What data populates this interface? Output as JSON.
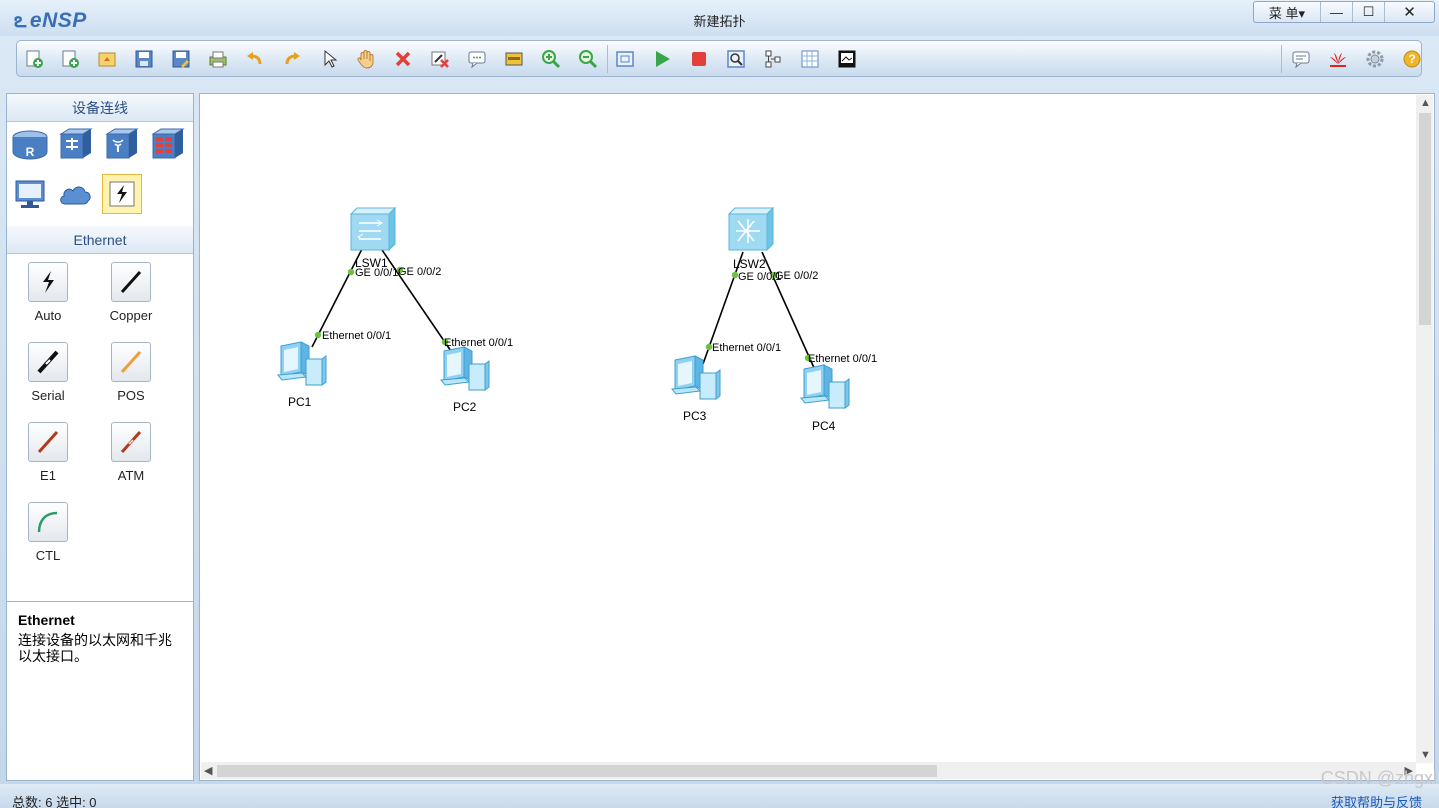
{
  "app": {
    "name": "eNSP",
    "window_title": "新建拓扑"
  },
  "window_buttons": {
    "menu": "菜 单▾",
    "minimize": "—",
    "maximize": "☐",
    "close": "✕"
  },
  "toolbar": {
    "buttons": [
      "new-topology-icon",
      "new-blank-topology-icon",
      "open-icon",
      "save-icon",
      "save-as-icon",
      "print-icon",
      "undo-icon",
      "redo-icon",
      "select-icon",
      "hand-icon",
      "delete-icon",
      "delete-link-icon",
      "text-comment-icon",
      "rectangle-icon",
      "zoom-in-icon",
      "zoom-out-icon",
      "fit-view-icon",
      "start-device-icon",
      "stop-device-icon",
      "capture-data-icon",
      "show-interfaces-icon",
      "palette-icon",
      "topology-icon"
    ],
    "right_buttons": [
      "chat-icon",
      "huawei-icon",
      "settings-icon",
      "help-icon"
    ],
    "colors": {
      "green": "#3aa64a",
      "red": "#e2403b",
      "yellow": "#f0c23a",
      "blue": "#5b87c5"
    }
  },
  "left_panel": {
    "devices_header": "设备连线",
    "devices": [
      "router-icon",
      "switch-icon",
      "wireless-icon",
      "firewall-icon",
      "pc-icon",
      "cloud-icon",
      "cable-icon"
    ],
    "cable_section_header": "Ethernet",
    "cables": [
      {
        "label": "Auto",
        "color": "#111111"
      },
      {
        "label": "Copper",
        "color": "#111111"
      },
      {
        "label": "Serial",
        "color": "#111111"
      },
      {
        "label": "POS",
        "color": "#f39a3a"
      },
      {
        "label": "E1",
        "color": "#b23a1a"
      },
      {
        "label": "ATM",
        "color": "#b23a1a"
      },
      {
        "label": "CTL",
        "color": "#2e9a6a"
      }
    ],
    "description": {
      "title": "Ethernet",
      "text": "连接设备的以太网和千兆以太接口。"
    }
  },
  "topology": {
    "nodes": {
      "lsw1": "LSW1",
      "lsw2": "LSW2",
      "pc1": "PC1",
      "pc2": "PC2",
      "pc3": "PC3",
      "pc4": "PC4"
    },
    "ports": {
      "lsw1_a": "GE 0/0/1",
      "lsw1_b": "GE 0/0/2",
      "pc1": "Ethernet 0/0/1",
      "pc2": "Ethernet 0/0/1",
      "lsw2_a": "GE 0/0/1",
      "lsw2_b": "GE 0/0/2",
      "pc3": "Ethernet 0/0/1",
      "pc4": "Ethernet 0/0/1"
    },
    "port_color": "#6cc13d"
  },
  "status": {
    "counts": "总数: 6 选中: 0",
    "help": "获取帮助与反馈"
  },
  "watermark": "CSDN @zhgxl"
}
